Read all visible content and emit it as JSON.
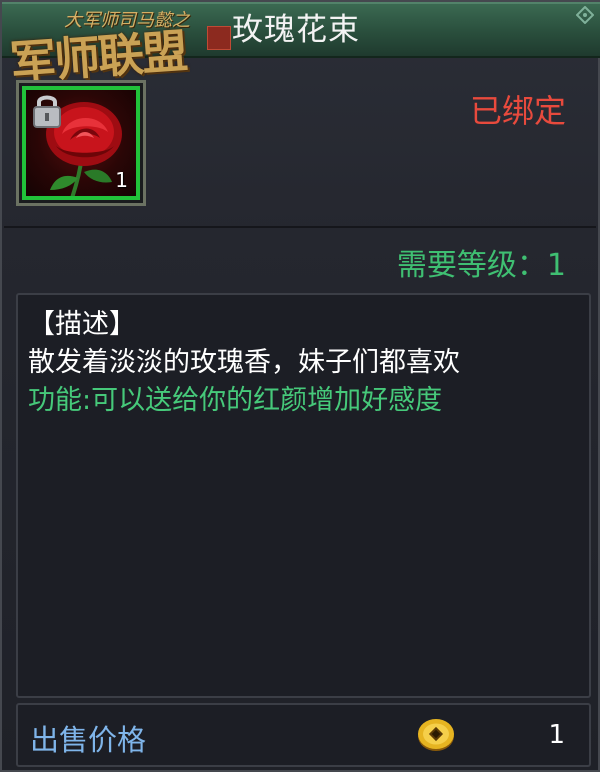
{
  "window": {
    "title": "玫瑰花束"
  },
  "logo": {
    "line1": "大军师司马懿之",
    "line2": "军师联盟"
  },
  "item": {
    "count": "1",
    "icon": "rose-icon",
    "locked_icon": "lock-icon",
    "frame_color": "#21c33a"
  },
  "status": {
    "bound": "已绑定",
    "bound_color": "#e84a3d"
  },
  "requirement": {
    "level_text": "需要等级：1",
    "color": "#3fbf72"
  },
  "description": {
    "header": "【描述】",
    "text": "散发着淡淡的玫瑰香，妹子们都喜欢",
    "function": "功能:可以送给你的红颜增加好感度",
    "function_color": "#46c97a"
  },
  "price": {
    "label": "出售价格",
    "value": "1",
    "currency_icon": "copper-coin-icon",
    "label_color": "#7fb5ea"
  }
}
